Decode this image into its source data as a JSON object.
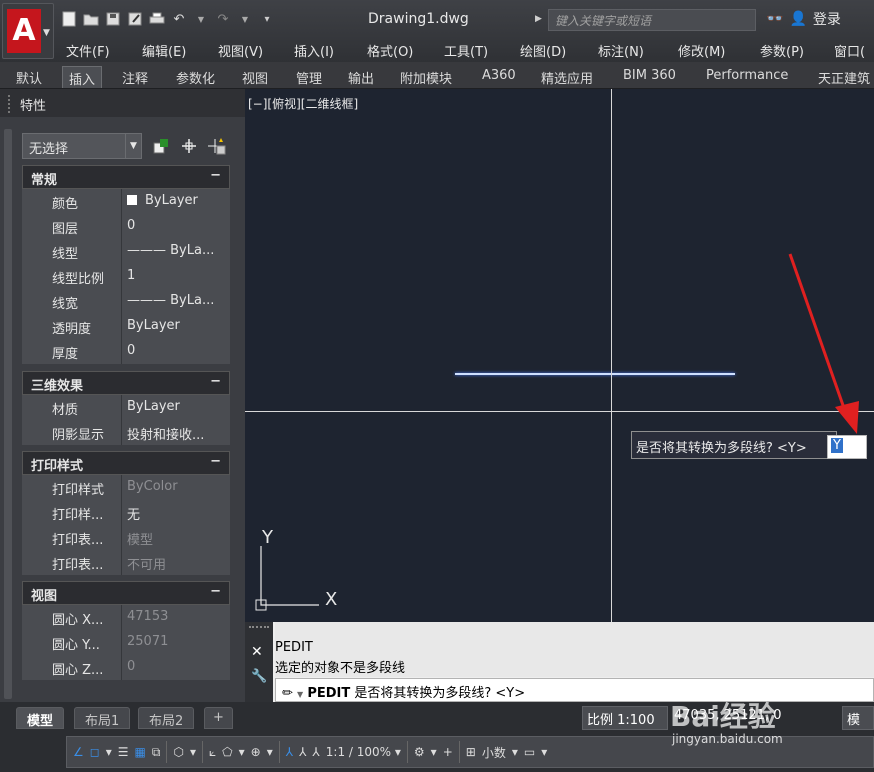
{
  "app": {
    "logo_letter": "A",
    "document_title": "Drawing1.dwg",
    "search_placeholder": "键入关键字或短语",
    "login_label": "登录"
  },
  "menubar": [
    "文件(F)",
    "编辑(E)",
    "视图(V)",
    "插入(I)",
    "格式(O)",
    "工具(T)",
    "绘图(D)",
    "标注(N)",
    "修改(M)",
    "参数(P)",
    "窗口("
  ],
  "ribbon_tabs": [
    "默认",
    "插入",
    "注释",
    "参数化",
    "视图",
    "管理",
    "输出",
    "附加模块",
    "A360",
    "精选应用",
    "BIM 360",
    "Performance",
    "天正建筑"
  ],
  "ribbon_active": "插入",
  "properties": {
    "title": "特性",
    "selection": "无选择",
    "sections": [
      {
        "name": "常规",
        "rows": [
          {
            "k": "颜色",
            "v": "ByLayer",
            "swatch": true
          },
          {
            "k": "图层",
            "v": "0"
          },
          {
            "k": "线型",
            "v": "——— ByLa..."
          },
          {
            "k": "线型比例",
            "v": "1"
          },
          {
            "k": "线宽",
            "v": "——— ByLa..."
          },
          {
            "k": "透明度",
            "v": "ByLayer"
          },
          {
            "k": "厚度",
            "v": "0"
          }
        ]
      },
      {
        "name": "三维效果",
        "rows": [
          {
            "k": "材质",
            "v": "ByLayer"
          },
          {
            "k": "阴影显示",
            "v": "投射和接收..."
          }
        ]
      },
      {
        "name": "打印样式",
        "rows": [
          {
            "k": "打印样式",
            "v": "ByColor",
            "dim": true
          },
          {
            "k": "打印样...",
            "v": "无"
          },
          {
            "k": "打印表...",
            "v": "模型",
            "dim": true
          },
          {
            "k": "打印表...",
            "v": "不可用",
            "dim": true
          }
        ]
      },
      {
        "name": "视图",
        "rows": [
          {
            "k": "圆心 X...",
            "v": "47153",
            "dim": true
          },
          {
            "k": "圆心 Y...",
            "v": "25071",
            "dim": true
          },
          {
            "k": "圆心 Z...",
            "v": "0",
            "dim": true
          }
        ]
      }
    ],
    "collapse_symbol": "−"
  },
  "viewport": {
    "label": "[−][俯视][二维线框]",
    "dynamic_prompt": "是否将其转换为多段线? <Y>",
    "dynamic_input": "Y",
    "ucs_x": "X",
    "ucs_y": "Y"
  },
  "command": {
    "history": [
      "PEDIT",
      "选定的对象不是多段线"
    ],
    "input_cmd": "PEDIT",
    "input_prompt": " 是否将其转换为多段线? <Y>"
  },
  "layout_tabs": [
    "模型",
    "布局1",
    "布局2"
  ],
  "layout_active": "模型",
  "layout_add": "+",
  "status": {
    "scale": "比例 1:100 ▾",
    "coords": "47035, 25121, 0",
    "model": "模型",
    "zoom": "1:1 / 100% ▾",
    "units": "小数"
  },
  "watermark": {
    "logo": "Bai经验",
    "url": "jingyan.baidu.com"
  },
  "colors": {
    "accent_red": "#c5161d",
    "viewport_bg": "#1e2430",
    "selection_blue": "#3071c9",
    "arrow_red": "#e02020"
  }
}
